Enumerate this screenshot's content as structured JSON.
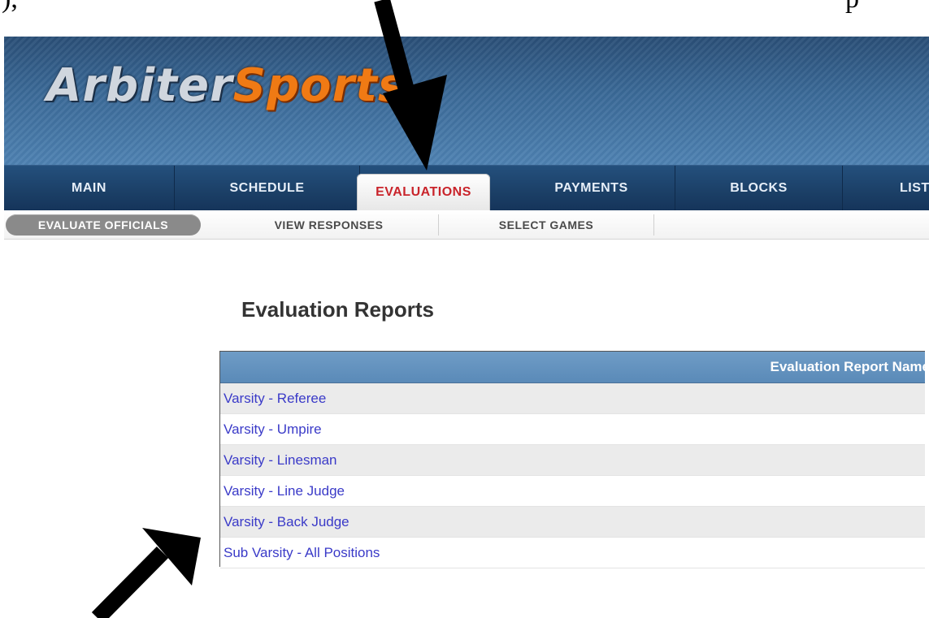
{
  "document_text": {
    "left": "),",
    "right": "p"
  },
  "app": {
    "logo": {
      "part1": "Arbiter",
      "part2": "Sports"
    }
  },
  "main_nav": {
    "items": [
      {
        "label": "MAIN",
        "active": false
      },
      {
        "label": "SCHEDULE",
        "active": false
      },
      {
        "label": "EVALUATIONS",
        "active": true
      },
      {
        "label": "PAYMENTS",
        "active": false
      },
      {
        "label": "BLOCKS",
        "active": false
      },
      {
        "label": "LIST",
        "active": false
      }
    ]
  },
  "sub_nav": {
    "items": [
      {
        "label": "EVALUATE OFFICIALS",
        "active": true
      },
      {
        "label": "VIEW RESPONSES",
        "active": false
      },
      {
        "label": "SELECT GAMES",
        "active": false
      }
    ]
  },
  "page": {
    "title": "Evaluation Reports"
  },
  "report_table": {
    "header": "Evaluation Report Name",
    "rows": [
      "Varsity - Referee",
      "Varsity - Umpire",
      "Varsity - Linesman",
      "Varsity - Line Judge",
      "Varsity - Back Judge",
      "Sub Varsity - All Positions"
    ]
  },
  "annotations": {
    "arrow_color": "#000000"
  },
  "colors": {
    "banner": "#3b6a98",
    "nav_bg": "#1b3f66",
    "active_tab_text": "#c9242b",
    "link": "#3a3ac8",
    "table_header": "#5a8ab8"
  }
}
